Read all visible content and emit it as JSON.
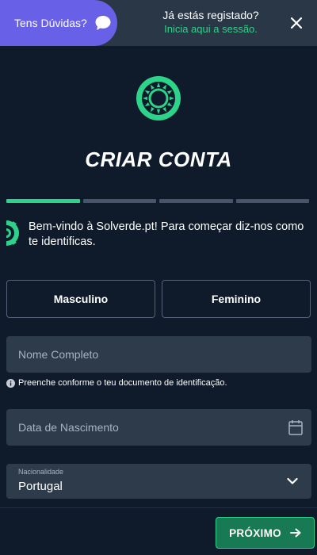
{
  "header": {
    "help_label": "Tens Dúvidas?",
    "login_question": "Já estás registado?",
    "login_link": "Inicia aqui a sessão."
  },
  "title": "CRIAR CONTA",
  "progress": {
    "current_step": 1,
    "total_steps": 4
  },
  "welcome_text": "Bem-vindo à Solverde.pt! Para começar diz-nos como te identificas.",
  "gender": {
    "male_label": "Masculino",
    "female_label": "Feminino"
  },
  "form": {
    "name_placeholder": "Nome Completo",
    "name_hint": "Preenche conforme o teu documento de identificação.",
    "birthdate_placeholder": "Data de Nascimento",
    "nationality_label": "Nacionalidade",
    "nationality_value": "Portugal"
  },
  "footer": {
    "next_label": "PRÓXIMO"
  },
  "colors": {
    "background": "#0f1a2a",
    "topbar": "#2a3747",
    "help_pill": "#6860e6",
    "accent_green": "#2ed38a",
    "button_green": "#177a55",
    "input_bg": "#2e3b4b"
  },
  "icons": [
    "chat-icon",
    "close-icon",
    "sun-logo-icon",
    "info-icon",
    "calendar-icon",
    "chevron-down-icon",
    "arrow-right-icon"
  ]
}
